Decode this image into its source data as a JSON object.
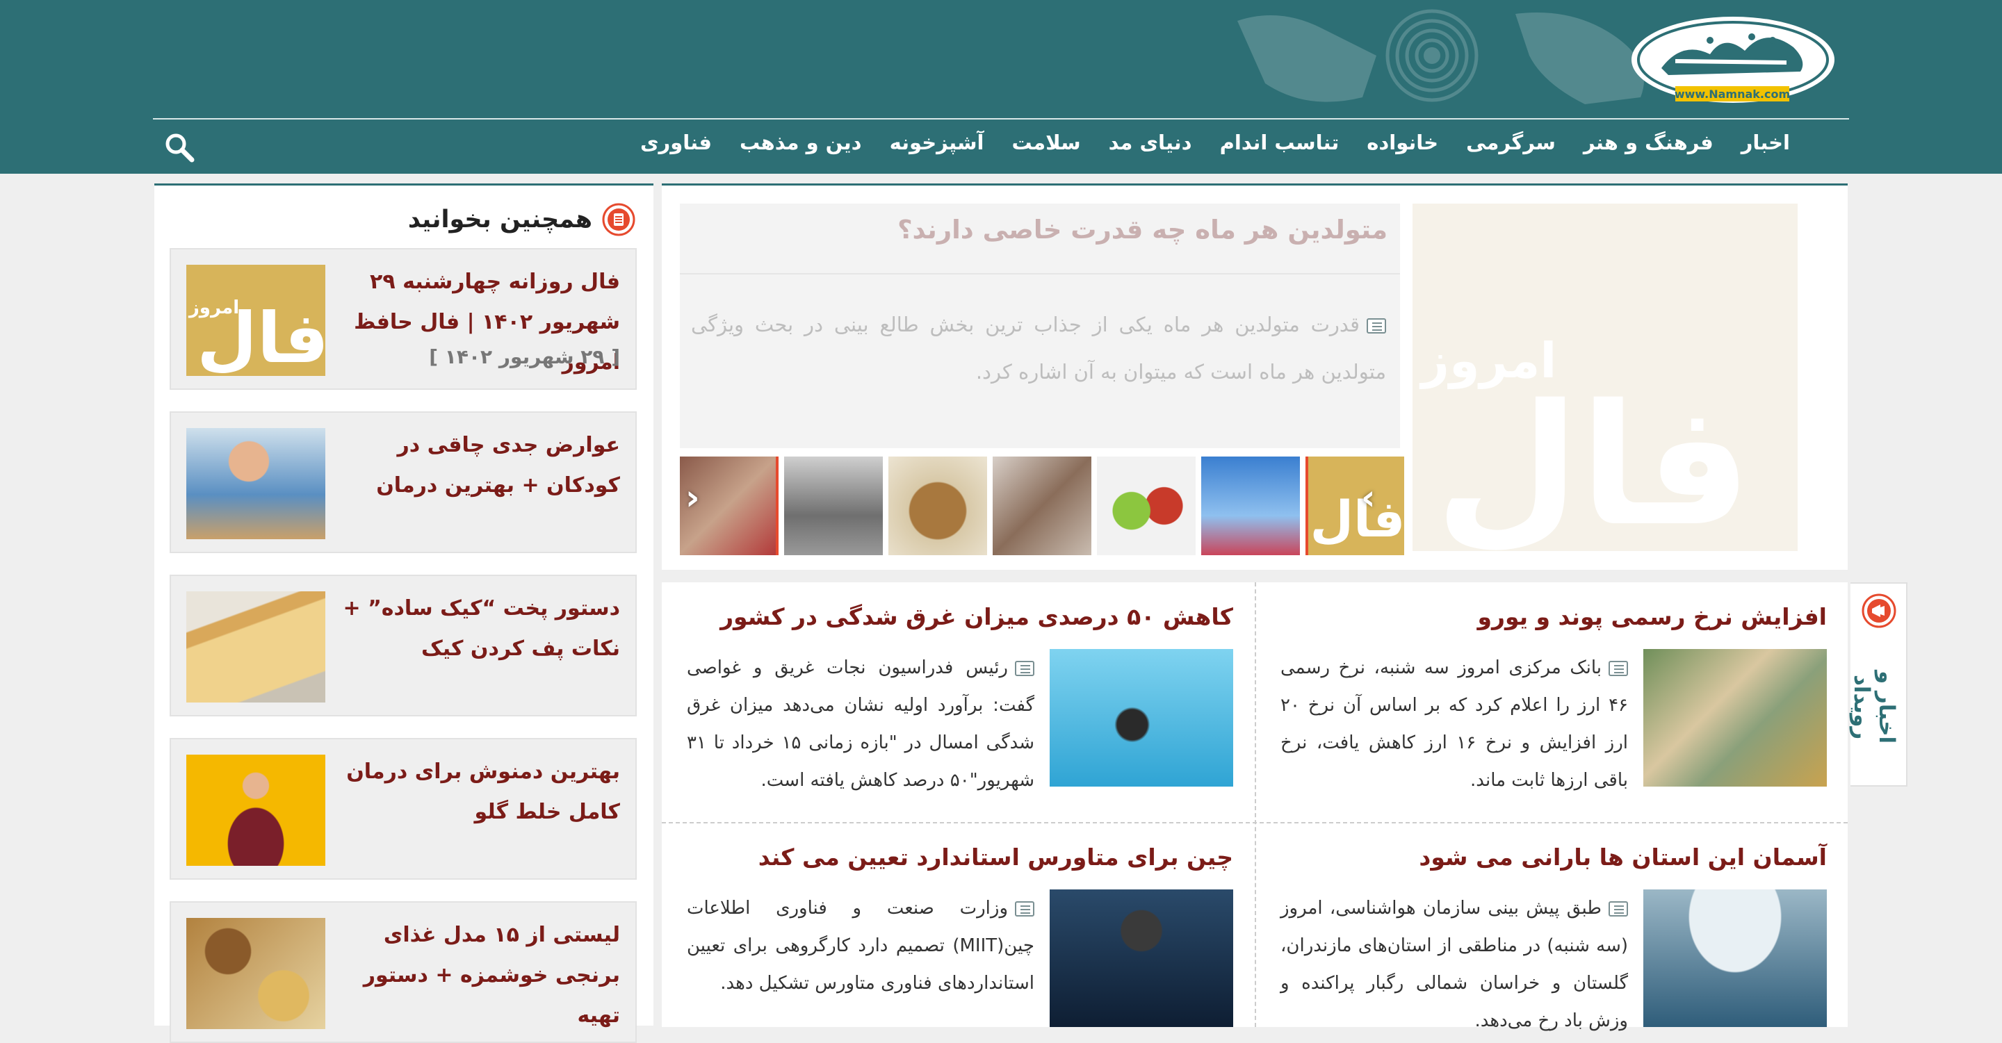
{
  "header": {
    "logo_text": "نمناک",
    "logo_url": "www.Namnak.com",
    "nav": [
      "اخبار",
      "فرهنگ و هنر",
      "سرگرمی",
      "خانواده",
      "تناسب اندام",
      "دنیای مد",
      "سلامت",
      "آشپزخونه",
      "دین و مذهب",
      "فناوری"
    ],
    "search_icon": "search-icon"
  },
  "sidetab": {
    "label": "اخبار و رویداد"
  },
  "featured": {
    "title": "متولدین هر ماه چه قدرت خاصی دارند؟",
    "description": "قدرت متولدین هر ماه یکی از جذاب ترین بخش طالع بینی در بحث ویژگی متولدین هر ماه است که میتوان به آن اشاره کرد."
  },
  "news": [
    {
      "title": "افزایش نرخ رسمی پوند و یورو",
      "text": "بانک مرکزی امروز سه شنبه، نرخ رسمی ۴۶ ارز را اعلام کرد که بر اساس آن نرخ ۲۰ ارز افزایش و نرخ ۱۶ ارز کاهش یافت، نرخ باقی ارزها ثابت ماند."
    },
    {
      "title": "کاهش ۵۰ درصدی میزان غرق شدگی در کشور",
      "text": "رئیس فدراسیون نجات غریق و غواصی گفت: برآورد اولیه نشان می‌دهد میزان غرق شدگی امسال در \"بازه زمانی ۱۵ خرداد تا ۳۱ شهریور\"۵۰ درصد کاهش یافته است."
    },
    {
      "title": "آسمان این استان ها بارانی می شود",
      "text": "طبق پیش بینی سازمان هواشناسی، امروز (سه شنبه) در مناطقی از استان‌های مازندران، گلستان و خراسان شمالی رگبار پراکنده و وزش باد رخ می‌دهد."
    },
    {
      "title": "چین برای متاورس استاندارد تعیین می کند",
      "text": "وزارت صنعت و فناوری اطلاعات چین(MIIT) تصمیم دارد کارگروهی برای تعیین استانداردهای فناوری متاورس تشکیل دهد."
    }
  ],
  "sidebar": {
    "title": "همچنین بخوانید",
    "items": [
      {
        "title": "فال روزانه چهارشنبه ۲۹ شهریور ۱۴۰۲ | فال حافظ امروز",
        "date": "[ ۲۹ شهریور ۱۴۰۲ ]",
        "img_text_big": "فال",
        "img_text_small": "امروز"
      },
      {
        "title": "عوارض جدی چاقی در کودکان + بهترین درمان"
      },
      {
        "title": "دستور پخت “کیک ساده” + نکات پف کردن کیک"
      },
      {
        "title": "بهترین دمنوش برای درمان کامل خلط گلو"
      },
      {
        "title": "لیستی از ۱۵ مدل غذای برنجی خوشمزه + دستور تهیه"
      }
    ]
  },
  "colors": {
    "header": "#2d6f75",
    "title": "#7b1c18",
    "accent": "#e64a2e"
  }
}
